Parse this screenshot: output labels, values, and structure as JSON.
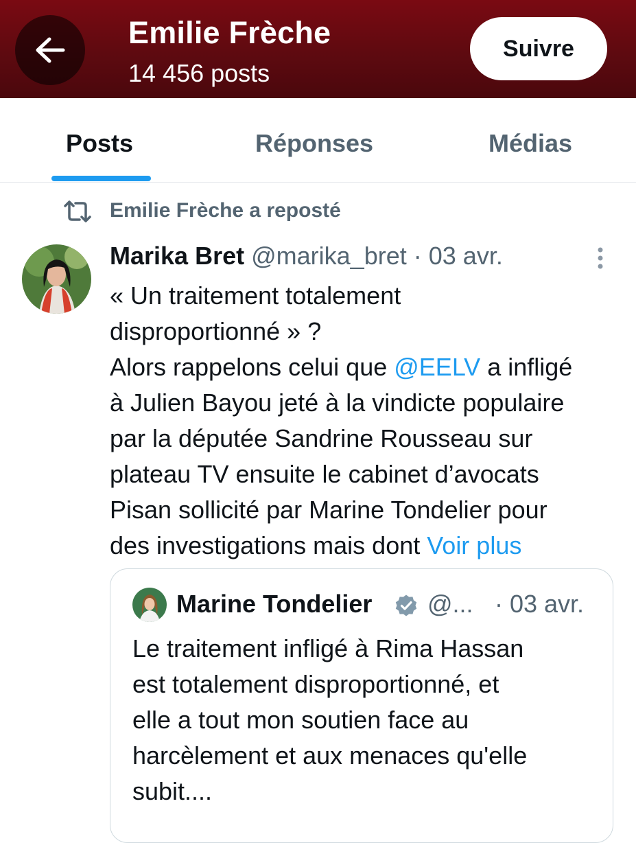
{
  "header": {
    "profile_name": "Emilie Frèche",
    "post_count": "14 456 posts",
    "follow_label": "Suivre",
    "back_icon": "arrow-left-icon",
    "background_color": "#6a0a10"
  },
  "tabs": [
    {
      "label": "Posts",
      "active": true
    },
    {
      "label": "Réponses",
      "active": false
    },
    {
      "label": "Médias",
      "active": false
    }
  ],
  "accent_color": "#1d9bf0",
  "repost": {
    "icon": "repost-icon",
    "text": "Emilie Frèche a reposté"
  },
  "post": {
    "author": "Marika Bret",
    "handle": "@marika_bret",
    "separator": "·",
    "date": "03 avr.",
    "more_icon": "more-vertical-icon",
    "body": {
      "l1": "« Un traitement totalement",
      "l2": "disproportionné » ?",
      "l3_pre": "Alors rappelons celui que ",
      "l3_mention": "@EELV",
      "l3_post": " a infligé",
      "l4": "à Julien Bayou jeté à la vindicte populaire",
      "l5": "par la députée Sandrine Rousseau sur",
      "l6": "plateau TV ensuite le cabinet d’avocats",
      "l7": "Pisan sollicité par Marine Tondelier pour",
      "l8_pre": "des investigations mais dont ",
      "l8_link": "Voir plus"
    }
  },
  "quote": {
    "author": "Marine Tondelier",
    "verified_icon": "verified-badge-icon",
    "handle": "@...",
    "date": "· 03 avr.",
    "body": {
      "l1": "Le traitement infligé à Rima Hassan",
      "l2": "est totalement disproportionné, et",
      "l3": "elle a tout mon soutien face au",
      "l4": "harcèlement et aux menaces qu'elle",
      "l5": "subit...."
    }
  }
}
